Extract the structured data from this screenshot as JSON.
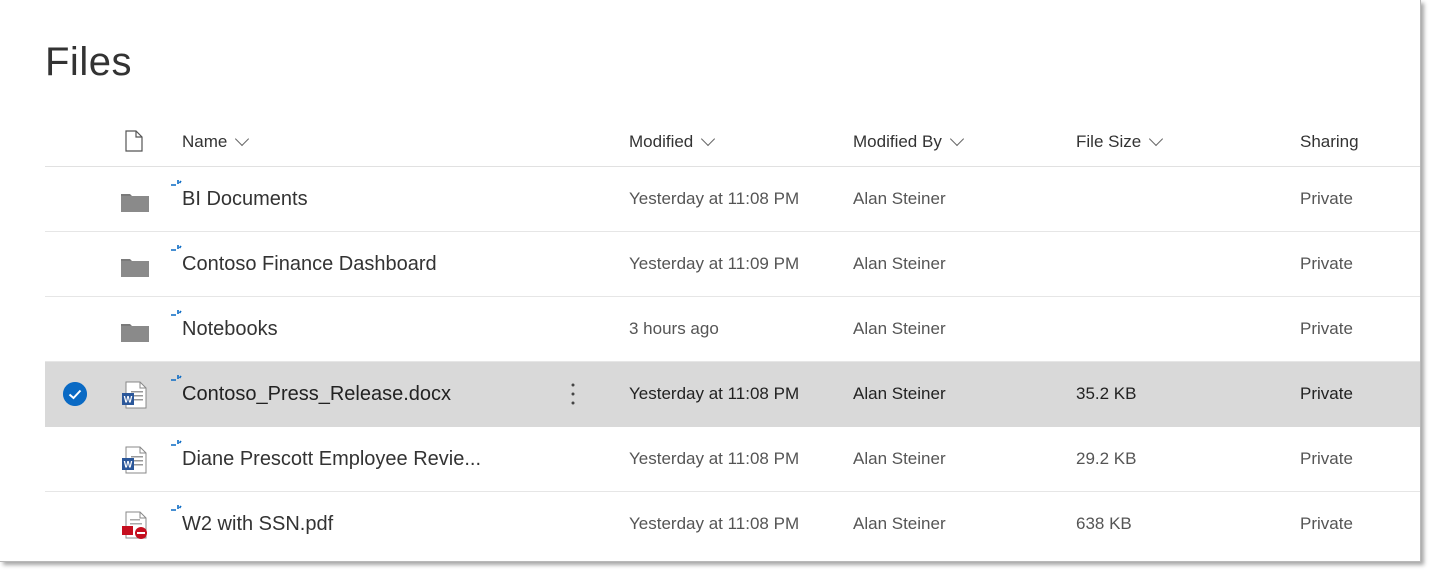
{
  "page": {
    "title": "Files"
  },
  "columns": {
    "filetype_icon": "file-type-column-icon",
    "name": "Name",
    "modified": "Modified",
    "modified_by": "Modified By",
    "file_size": "File Size",
    "sharing": "Sharing"
  },
  "files": [
    {
      "type": "folder",
      "icon": "folder-icon",
      "name": "BI Documents",
      "modified": "Yesterday at 11:08 PM",
      "modified_by": "Alan Steiner",
      "size": "",
      "sharing": "Private",
      "selected": false
    },
    {
      "type": "folder",
      "icon": "folder-icon",
      "name": "Contoso Finance Dashboard",
      "modified": "Yesterday at 11:09 PM",
      "modified_by": "Alan Steiner",
      "size": "",
      "sharing": "Private",
      "selected": false
    },
    {
      "type": "folder",
      "icon": "folder-icon",
      "name": "Notebooks",
      "modified": "3 hours ago",
      "modified_by": "Alan Steiner",
      "size": "",
      "sharing": "Private",
      "selected": false
    },
    {
      "type": "word",
      "icon": "word-document-icon",
      "name": "Contoso_Press_Release.docx",
      "modified": "Yesterday at 11:08 PM",
      "modified_by": "Alan Steiner",
      "size": "35.2 KB",
      "sharing": "Private",
      "selected": true
    },
    {
      "type": "word",
      "icon": "word-document-icon",
      "name": "Diane Prescott Employee Revie...",
      "modified": "Yesterday at 11:08 PM",
      "modified_by": "Alan Steiner",
      "size": "29.2 KB",
      "sharing": "Private",
      "selected": false
    },
    {
      "type": "pdf-blocked",
      "icon": "pdf-blocked-icon",
      "name": "W2 with SSN.pdf",
      "modified": "Yesterday at 11:08 PM",
      "modified_by": "Alan Steiner",
      "size": "638 KB",
      "sharing": "Private",
      "selected": false
    }
  ],
  "colors": {
    "accent": "#0a6ac4",
    "selected_row": "#d9d9d9",
    "folder": "#7a7a7a",
    "word": "#2b579a",
    "blocked": "#c50f1f"
  }
}
